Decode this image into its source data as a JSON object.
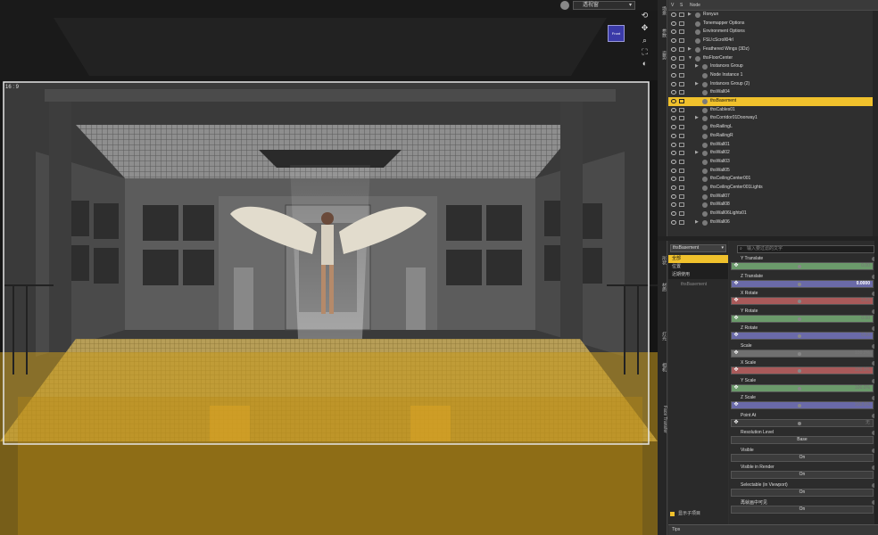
{
  "viewport": {
    "camera": "透视窗",
    "aspect": "16 : 9",
    "nav_cube_label": "Front"
  },
  "scene": {
    "columns": {
      "visibility": "V",
      "selection": "S",
      "node": "Node"
    },
    "rows": [
      {
        "label": "Ronyun",
        "indent": 1,
        "expand": "▶",
        "selected": false
      },
      {
        "label": "Tonemapper Options",
        "indent": 1,
        "expand": "",
        "selected": false
      },
      {
        "label": "Environment Options",
        "indent": 1,
        "expand": "",
        "selected": false
      },
      {
        "label": "FSL!cScroll04rl",
        "indent": 1,
        "expand": "",
        "selected": false
      },
      {
        "label": "Feathered Wings (3Dz)",
        "indent": 1,
        "expand": "▶",
        "selected": false
      },
      {
        "label": "thsFloorCenter",
        "indent": 1,
        "expand": "▼",
        "selected": false
      },
      {
        "label": "Instances Group",
        "indent": 2,
        "expand": "▶",
        "selected": false
      },
      {
        "label": "Node Instance 1",
        "indent": 2,
        "expand": "",
        "selected": false
      },
      {
        "label": "Instances Group (2)",
        "indent": 2,
        "expand": "▶",
        "selected": false
      },
      {
        "label": "thsWall04",
        "indent": 2,
        "expand": "",
        "selected": false
      },
      {
        "label": "thsBasement",
        "indent": 2,
        "expand": "",
        "selected": true
      },
      {
        "label": "thsCables01",
        "indent": 2,
        "expand": "",
        "selected": false
      },
      {
        "label": "thsCorridor01Doorway1",
        "indent": 2,
        "expand": "▶",
        "selected": false
      },
      {
        "label": "thsRailingL",
        "indent": 2,
        "expand": "",
        "selected": false
      },
      {
        "label": "thsRailingR",
        "indent": 2,
        "expand": "",
        "selected": false
      },
      {
        "label": "thsWall01",
        "indent": 2,
        "expand": "",
        "selected": false
      },
      {
        "label": "thsWall02",
        "indent": 2,
        "expand": "▶",
        "selected": false
      },
      {
        "label": "thsWall03",
        "indent": 2,
        "expand": "",
        "selected": false
      },
      {
        "label": "thsWall05",
        "indent": 2,
        "expand": "",
        "selected": false
      },
      {
        "label": "thsCeilingCenter001",
        "indent": 2,
        "expand": "",
        "selected": false
      },
      {
        "label": "thsCeilingCenter001Lights",
        "indent": 2,
        "expand": "",
        "selected": false
      },
      {
        "label": "thsWall07",
        "indent": 2,
        "expand": "",
        "selected": false
      },
      {
        "label": "thsWall08",
        "indent": 2,
        "expand": "",
        "selected": false
      },
      {
        "label": "thsWall06Lights01",
        "indent": 2,
        "expand": "",
        "selected": false
      },
      {
        "label": "thsWall06",
        "indent": 2,
        "expand": "▶",
        "selected": false
      }
    ]
  },
  "parameters": {
    "node_select": "thsBasement",
    "filter_placeholder": "输入要过滤的文字",
    "categories": [
      "全部",
      "位置",
      "近期使用"
    ],
    "tree_node": "thsBasement",
    "show_sub": "显示子项目",
    "tips": "Tips",
    "rows": [
      {
        "label": "Y Translate",
        "value": "0.00",
        "kind": "bar",
        "color": "#6b9a6b",
        "highlight": false
      },
      {
        "label": "Z Translate",
        "value": "0.0000",
        "kind": "bar",
        "color": "#6a6aa8",
        "highlight": true
      },
      {
        "label": "X Rotate",
        "value": "0.00",
        "kind": "bar",
        "color": "#a85a5a",
        "highlight": false
      },
      {
        "label": "Y Rotate",
        "value": "0.00",
        "kind": "bar",
        "color": "#6b9a6b",
        "highlight": false
      },
      {
        "label": "Z Rotate",
        "value": "0.00",
        "kind": "bar",
        "color": "#6a6aa8",
        "highlight": false
      },
      {
        "label": "Scale",
        "value": "100.0%",
        "kind": "bar",
        "color": "#707070",
        "highlight": false
      },
      {
        "label": "X Scale",
        "value": "100.0%",
        "kind": "bar",
        "color": "#a85a5a",
        "highlight": false
      },
      {
        "label": "Y Scale",
        "value": "100.0%",
        "kind": "bar",
        "color": "#6b9a6b",
        "highlight": false
      },
      {
        "label": "Z Scale",
        "value": "100.0%",
        "kind": "bar",
        "color": "#6a6aa8",
        "highlight": false
      },
      {
        "label": "Point At",
        "value": "无",
        "kind": "bar",
        "color": "#3c3c3c",
        "highlight": false
      },
      {
        "label": "Resolution Level",
        "value": "Base",
        "kind": "btn",
        "color": "#3c3c3c",
        "highlight": false
      },
      {
        "label": "Visible",
        "value": "On",
        "kind": "btn",
        "color": "#3c3c3c",
        "highlight": false
      },
      {
        "label": "Visible in Render",
        "value": "On",
        "kind": "btn",
        "color": "#3c3c3c",
        "highlight": false
      },
      {
        "label": "Selectable (in Viewport)",
        "value": "On",
        "kind": "btn",
        "color": "#3c3c3c",
        "highlight": false
      },
      {
        "label": "再就画中可见",
        "value": "On",
        "kind": "btn",
        "color": "#3c3c3c",
        "highlight": false
      }
    ]
  },
  "side_tabs": [
    "场景",
    "参数",
    "姿势",
    "形状",
    "材质",
    "灯光",
    "相机",
    "Face Transfer"
  ]
}
